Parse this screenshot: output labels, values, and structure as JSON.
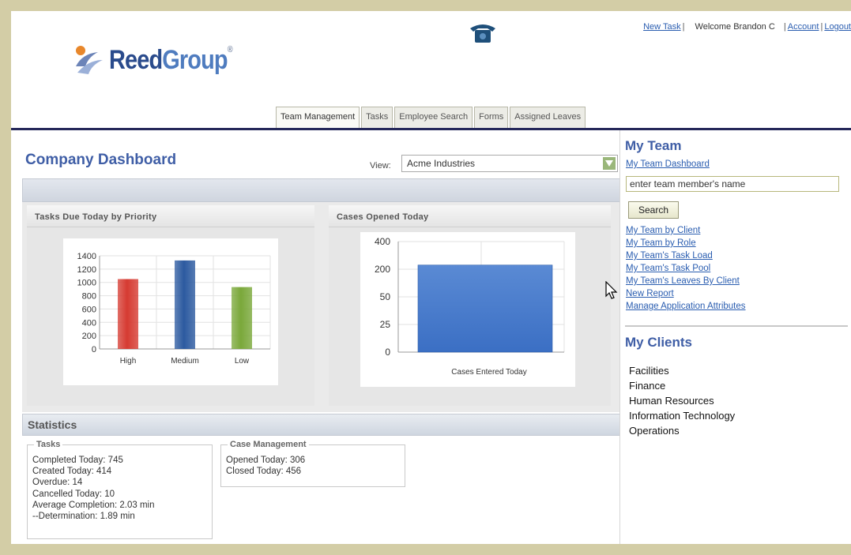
{
  "header": {
    "brand_reed": "Reed",
    "brand_group": "Group",
    "brand_mark": "®",
    "new_task": "New Task",
    "welcome": "Welcome Brandon C",
    "account": "Account",
    "logout": "Logout",
    "separator": "|"
  },
  "tabs": [
    {
      "label": "Team Management",
      "active": true
    },
    {
      "label": "Tasks",
      "active": false
    },
    {
      "label": "Employee Search",
      "active": false
    },
    {
      "label": "Forms",
      "active": false
    },
    {
      "label": "Assigned Leaves",
      "active": false
    }
  ],
  "dashboard": {
    "title": "Company Dashboard",
    "view_label": "View:",
    "view_value": "Acme Industries"
  },
  "chart_data": [
    {
      "type": "bar",
      "title": "Tasks Due Today by Priority",
      "categories": [
        "High",
        "Medium",
        "Low"
      ],
      "values": [
        1050,
        1330,
        930
      ],
      "colors": [
        "#d63b32",
        "#2c5aa0",
        "#7aa83a"
      ],
      "yticks": [
        "1400",
        "1200",
        "1000",
        "800",
        "600",
        "400",
        "200",
        "0"
      ],
      "ylim": [
        0,
        1400
      ],
      "grid": true
    },
    {
      "type": "bar",
      "title": "Cases Opened Today",
      "categories": [
        "Cases Entered Today"
      ],
      "values": [
        230
      ],
      "colors": [
        "#3b6fc4"
      ],
      "yticks": [
        "400",
        "200",
        "50",
        "25",
        "0"
      ],
      "grid": true
    }
  ],
  "statistics": {
    "title": "Statistics",
    "tasks": {
      "legend": "Tasks",
      "lines": [
        "Completed Today:  745",
        "Created Today:  414",
        "Overdue:  14",
        "Cancelled Today:  10",
        "Average Completion:  2.03 min",
        "--Determination:  1.89 min"
      ]
    },
    "cases": {
      "legend": "Case Management",
      "lines": [
        "Opened Today: 306",
        "Closed Today: 456"
      ]
    }
  },
  "my_team": {
    "title": "My Team",
    "dashboard_link": "My Team Dashboard",
    "search_value": "enter team member's name",
    "search_button": "Search",
    "links": [
      "My Team by Client",
      "My Team by Role",
      "My Team's Task Load",
      "My Team's Task Pool",
      "My Team's Leaves By Client",
      "New Report",
      "Manage Application Attributes"
    ]
  },
  "my_clients": {
    "title": "My Clients",
    "items": [
      "Facilities",
      "Finance",
      "Human Resources",
      "Information Technology",
      "Operations"
    ]
  }
}
